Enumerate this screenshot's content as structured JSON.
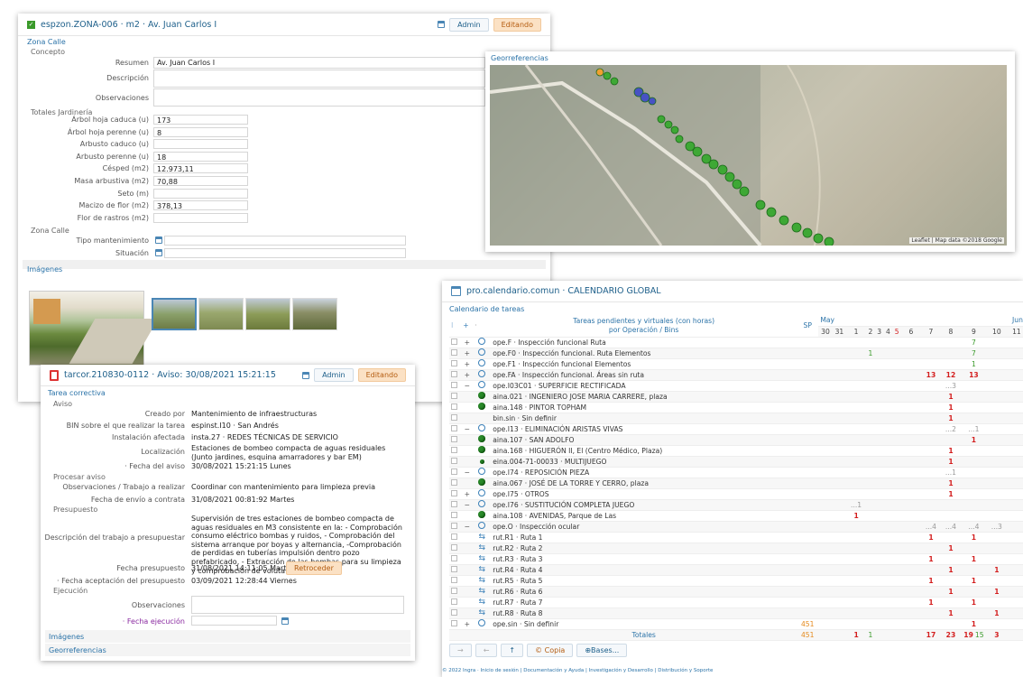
{
  "w1": {
    "title": "espzon.ZONA-006  ·  m2  ·  Av. Juan Carlos I",
    "admin": "Admin",
    "edit": "Editando",
    "zona_calle": "Zona Calle",
    "concepto": "Concepto",
    "resumen_l": "Resumen",
    "resumen": "Av. Juan Carlos I",
    "descripcion_l": "Descripción",
    "observaciones_l": "Observaciones",
    "totales": "Totales Jardinería",
    "fields": [
      {
        "l": "Árbol hoja caduca (u)",
        "v": "173"
      },
      {
        "l": "Árbol hoja perenne (u)",
        "v": "8"
      },
      {
        "l": "Arbusto caduco (u)",
        "v": ""
      },
      {
        "l": "Arbusto perenne (u)",
        "v": "18"
      },
      {
        "l": "Césped (m2)",
        "v": "12.973,11"
      },
      {
        "l": "Masa arbustiva (m2)",
        "v": "70,88"
      },
      {
        "l": "Seto (m)",
        "v": ""
      },
      {
        "l": "Macizo de flor (m2)",
        "v": "378,13"
      },
      {
        "l": "Flor de rastros (m2)",
        "v": ""
      }
    ],
    "zona_calle2": "Zona Calle",
    "tipo_l": "Tipo mantenimiento",
    "situacion_l": "Situación",
    "imagenes": "Imágenes"
  },
  "geo": {
    "title": "Georreferencias",
    "attr": "Leaflet | Map data ©2018 Google"
  },
  "w3": {
    "title": "tarcor.210830-0112  ·  Aviso: 30/08/2021 15:21:15",
    "admin": "Admin",
    "edit": "Editando",
    "tarea": "Tarea correctiva",
    "aviso": "Aviso",
    "rows": [
      {
        "l": "Creado por",
        "v": "Mantenimiento de infraestructuras"
      },
      {
        "l": "BIN sobre el que realizar la tarea",
        "v": "espinst.I10 · San Andrés"
      },
      {
        "l": "Instalación afectada",
        "v": "insta.27 · REDES TÉCNICAS DE SERVICIO"
      },
      {
        "l": "Localización",
        "v": "Estaciones de bombeo compacta de aguas residuales (Junto jardines, esquina amarradores y bar EM)"
      },
      {
        "l": "· Fecha del aviso",
        "v": "30/08/2021 15:21:15 Lunes"
      }
    ],
    "procesar": "Procesar aviso",
    "obs_l": "Observaciones / Trabajo a realizar",
    "obs": "Coordinar con mantenimiento para limpieza previa",
    "envio_l": "Fecha de envío a contrata",
    "envio": "31/08/2021 00:81:92 Martes",
    "presupuesto": "Presupuesto",
    "desc_l": "Descripción del trabajo a presupuestar",
    "desc": "Supervisión de tres estaciones de bombeo compacta de aguas residuales en M3 consistente en la: - Comprobación consumo eléctrico bombas y ruidos, - Comprobación del sistema arranque por boyas y alternancia, -Comprobación de perdidas en tuberías impulsión dentro pozo prefabricado, - Extracción de las bombas para su limpieza y comprobación de voluta y rodete.",
    "fpres_l": "Fecha presupuesto",
    "fpres": "31/08/2021 14:11:05 Martes",
    "retroceder": "Retroceder",
    "facep_l": "· Fecha aceptación del presupuesto",
    "facep": "03/09/2021 12:28:44 Viernes",
    "ejecucion": "Ejecución",
    "obs2_l": "Observaciones",
    "fejec_l": "· Fecha ejecución",
    "imagenes": "Imágenes",
    "geo": "Georreferencias"
  },
  "w4": {
    "title": "pro.calendario.comun  ·  CALENDARIO GLOBAL",
    "sub": "Calendario de tareas",
    "h1": "Tareas pendientes y virtuales (con horas)",
    "h2": "por Operación / Bins",
    "sp": "SP",
    "may": "May",
    "jun": "Juni",
    "days": [
      "30",
      "31",
      "1",
      "2",
      "3",
      "4",
      "5",
      "6",
      "7",
      "8",
      "9",
      "10",
      "11"
    ],
    "rows": [
      {
        "i": "alarm",
        "e": "+",
        "t": "ope.F · Inspección funcional Ruta",
        "c": {
          "10": [
            "7",
            "g"
          ]
        }
      },
      {
        "i": "alarm",
        "e": "+",
        "t": "ope.F0 · Inspección funcional. Ruta Elementos",
        "c": {
          "3": [
            "1",
            "g"
          ],
          "10": [
            "7",
            "g"
          ]
        }
      },
      {
        "i": "alarm",
        "e": "+",
        "t": "ope.F1 · Inspección funcional Elementos",
        "c": {
          "10": [
            "1",
            "g"
          ]
        }
      },
      {
        "i": "alarm",
        "e": "+",
        "t": "ope.FA · Inspección funcional. Áreas sin ruta",
        "c": {
          "8": [
            "13",
            "r"
          ],
          "9": [
            "12",
            "r"
          ],
          "10": [
            "13",
            "r"
          ]
        }
      },
      {
        "i": "alarm",
        "e": "−",
        "t": "ope.I03C01 · SUPERFICIE RECTIFICADA",
        "c": {
          "9": [
            "...3",
            "gy"
          ]
        }
      },
      {
        "i": "dot",
        "e": "",
        "t": "aina.021 · INGENIERO JOSE MARIA CARRERE, plaza",
        "c": {
          "9": [
            "1",
            "r"
          ]
        }
      },
      {
        "i": "dot",
        "e": "",
        "t": "aina.148 · PINTOR TOPHAM",
        "c": {
          "9": [
            "1",
            "r"
          ]
        }
      },
      {
        "i": "",
        "e": "",
        "t": "bin.sin · Sin definir",
        "c": {
          "9": [
            "1",
            "r"
          ]
        }
      },
      {
        "i": "alarm",
        "e": "−",
        "t": "ope.I13 · ELIMINACIÓN ARISTAS VIVAS",
        "c": {
          "9": [
            "...2",
            "gy"
          ],
          "10": [
            "...1",
            "gy"
          ]
        }
      },
      {
        "i": "dot",
        "e": "",
        "t": "aina.107 · SAN ADOLFO",
        "c": {
          "10": [
            "1",
            "r"
          ]
        }
      },
      {
        "i": "dot",
        "e": "",
        "t": "aina.168 · HIGUERÓN II, El (Centro Médico, Plaza)",
        "c": {
          "9": [
            "1",
            "r"
          ]
        }
      },
      {
        "i": "sdot",
        "e": "",
        "t": "eina.004-71-00033 · MULTIJUEGO",
        "c": {
          "9": [
            "1",
            "r"
          ]
        }
      },
      {
        "i": "alarm",
        "e": "−",
        "t": "ope.I74 · REPOSICIÓN PIEZA",
        "c": {
          "9": [
            "...1",
            "gy"
          ]
        }
      },
      {
        "i": "dot",
        "e": "",
        "t": "aina.067 · JOSÉ DE LA TORRE Y CERRO, plaza",
        "c": {
          "9": [
            "1",
            "r"
          ]
        }
      },
      {
        "i": "alarm",
        "e": "+",
        "t": "ope.I75 · OTROS",
        "c": {
          "9": [
            "1",
            "r"
          ]
        }
      },
      {
        "i": "alarm",
        "e": "−",
        "t": "ope.I76 · SUSTITUCIÓN COMPLETA JUEGO",
        "c": {
          "2": [
            "...1",
            "gy"
          ]
        }
      },
      {
        "i": "dot",
        "e": "",
        "t": "aina.108 · AVENIDAS, Parque de Las",
        "c": {
          "2": [
            "1",
            "r"
          ]
        }
      },
      {
        "i": "alarm",
        "e": "−",
        "t": "ope.O · Inspección ocular",
        "c": {
          "8": [
            "...4",
            "gy"
          ],
          "9": [
            "...4",
            "gy"
          ],
          "10": [
            "...4",
            "gy"
          ],
          "11": [
            "...3",
            "gy"
          ]
        }
      },
      {
        "i": "route",
        "e": "",
        "t": "rut.R1 · Ruta 1",
        "c": {
          "8": [
            "1",
            "r"
          ],
          "10": [
            "1",
            "r"
          ]
        }
      },
      {
        "i": "route",
        "e": "",
        "t": "rut.R2 · Ruta 2",
        "c": {
          "9": [
            "1",
            "r"
          ]
        }
      },
      {
        "i": "route",
        "e": "",
        "t": "rut.R3 · Ruta 3",
        "c": {
          "8": [
            "1",
            "r"
          ],
          "10": [
            "1",
            "r"
          ]
        }
      },
      {
        "i": "route",
        "e": "",
        "t": "rut.R4 · Ruta 4",
        "c": {
          "9": [
            "1",
            "r"
          ],
          "11": [
            "1",
            "r"
          ]
        }
      },
      {
        "i": "route",
        "e": "",
        "t": "rut.R5 · Ruta 5",
        "c": {
          "8": [
            "1",
            "r"
          ],
          "10": [
            "1",
            "r"
          ]
        }
      },
      {
        "i": "route",
        "e": "",
        "t": "rut.R6 · Ruta 6",
        "c": {
          "9": [
            "1",
            "r"
          ],
          "11": [
            "1",
            "r"
          ]
        }
      },
      {
        "i": "route",
        "e": "",
        "t": "rut.R7 · Ruta 7",
        "c": {
          "8": [
            "1",
            "r"
          ],
          "10": [
            "1",
            "r"
          ]
        }
      },
      {
        "i": "route",
        "e": "",
        "t": "rut.R8 · Ruta 8",
        "c": {
          "9": [
            "1",
            "r"
          ],
          "11": [
            "1",
            "r"
          ]
        }
      },
      {
        "i": "alarm",
        "e": "+",
        "t": "ope.sin · Sin definir",
        "sp": "451",
        "c": {
          "10": [
            "1",
            "r"
          ]
        }
      }
    ],
    "totales": "Totales",
    "tot_sp": "451",
    "tot": {
      "2": [
        "1",
        "r"
      ],
      "3": [
        "1",
        "g"
      ],
      "8": [
        "17",
        "r"
      ],
      "9": [
        "23",
        "r"
      ],
      "10": [
        "19",
        "r"
      ],
      "11": [
        "3",
        "r"
      ]
    },
    "tot_extra": "15",
    "copia": "© Copia",
    "bases": "⊕Bases...",
    "footer": "© 2022 Ingra  ·  Inicio de sesión | Documentación y Ayuda | Investigación y Desarrollo | Distribución y Soporte"
  }
}
